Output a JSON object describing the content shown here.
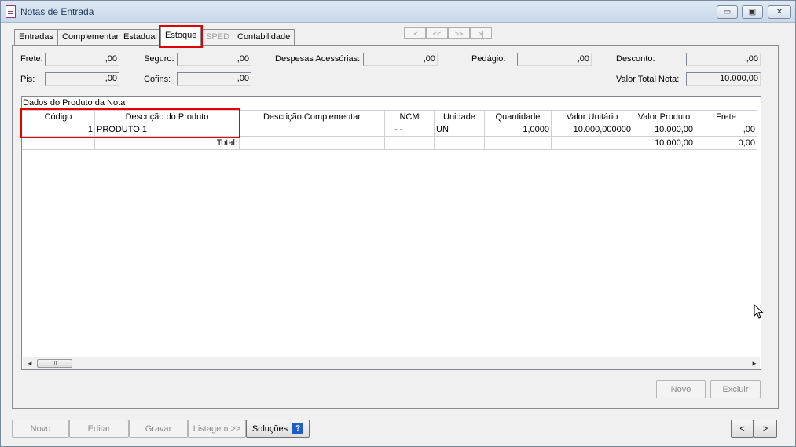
{
  "window": {
    "title": "Notas de Entrada",
    "controls": {
      "minimize": "▭",
      "maximize": "▣",
      "close": "✕"
    }
  },
  "tabs": [
    {
      "label": "Entradas"
    },
    {
      "label": "Complementar"
    },
    {
      "label": "Estadual"
    },
    {
      "label": "Estoque",
      "active": true
    },
    {
      "label": "SPED",
      "disabled": true
    },
    {
      "label": "Contabilidade"
    }
  ],
  "record_nav": {
    "first": "|<",
    "prev": "<<",
    "next": ">>",
    "last": ">|"
  },
  "totals_fields": {
    "frete": {
      "label": "Frete:",
      "value": ",00"
    },
    "seguro": {
      "label": "Seguro:",
      "value": ",00"
    },
    "despesas": {
      "label": "Despesas Acessórias:",
      "value": ",00"
    },
    "pedagio": {
      "label": "Pedágio:",
      "value": ",00"
    },
    "desconto": {
      "label": "Desconto:",
      "value": ",00"
    },
    "pis": {
      "label": "Pis:",
      "value": ",00"
    },
    "cofins": {
      "label": "Cofins:",
      "value": ",00"
    },
    "valor_total": {
      "label": "Valor Total Nota:",
      "value": "10.000,00"
    }
  },
  "grid": {
    "caption": "Dados do Produto da Nota",
    "columns": [
      "Código",
      "Descrição do Produto",
      "Descrição Complementar",
      "NCM",
      "Unidade",
      "Quantidade",
      "Valor Unitário",
      "Valor Produto",
      "Frete"
    ],
    "row": {
      "codigo": "1",
      "descricao": "PRODUTO 1",
      "complementar": "",
      "ncm": "- -",
      "unidade": "UN",
      "quantidade": "1,0000",
      "valor_unitario": "10.000,000000",
      "valor_produto": "10.000,00",
      "frete": ",00"
    },
    "total_row": {
      "label": "Total:",
      "valor_produto": "10.000,00",
      "frete": "0,00"
    },
    "scroll_thumb": "III",
    "scroll_left": "◄",
    "scroll_right": "►"
  },
  "grid_buttons": {
    "novo": "Novo",
    "excluir": "Excluir"
  },
  "bottom_buttons": {
    "novo": "Novo",
    "editar": "Editar",
    "gravar": "Gravar",
    "listagem": "Listagem >>",
    "solucoes": "Soluções",
    "help": "?",
    "prev": "<",
    "next": ">"
  },
  "colors": {
    "highlight": "#e00000",
    "help_blue": "#1c5fc5"
  }
}
